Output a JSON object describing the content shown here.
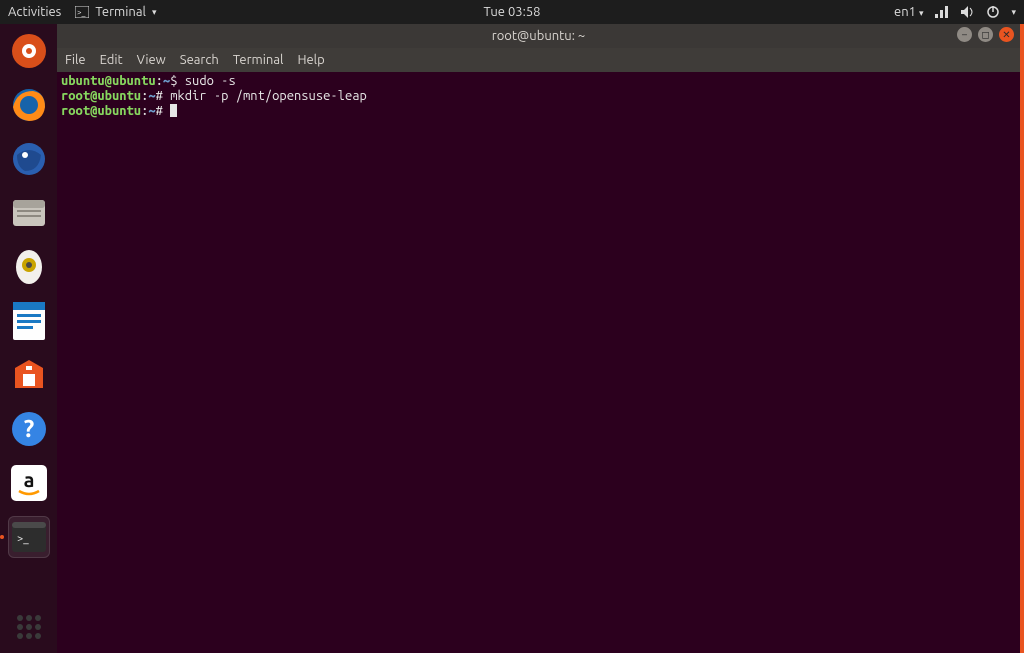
{
  "top": {
    "activities": "Activities",
    "app_label": "Terminal",
    "clock": "Tue 03:58",
    "lang": "en1"
  },
  "window": {
    "title": "root@ubuntu: ~"
  },
  "menu": {
    "file": "File",
    "edit": "Edit",
    "view": "View",
    "search": "Search",
    "terminal": "Terminal",
    "help": "Help"
  },
  "terminal": {
    "lines": [
      {
        "user": "ubuntu@ubuntu",
        "path": "~",
        "sep": "$",
        "cmd": "sudo -s"
      },
      {
        "user": "root@ubuntu",
        "path": "~",
        "sep": "#",
        "cmd": "mkdir -p /mnt/opensuse-leap"
      },
      {
        "user": "root@ubuntu",
        "path": "~",
        "sep": "#",
        "cmd": "",
        "cursor": true
      }
    ]
  },
  "dock": {
    "items": [
      {
        "name": "files-icon"
      },
      {
        "name": "firefox-icon"
      },
      {
        "name": "thunderbird-icon"
      },
      {
        "name": "filemanager-icon"
      },
      {
        "name": "rhythmbox-icon"
      },
      {
        "name": "writer-icon"
      },
      {
        "name": "software-icon"
      },
      {
        "name": "help-icon"
      },
      {
        "name": "amazon-icon"
      },
      {
        "name": "terminal-icon",
        "active": true,
        "running": true
      }
    ]
  }
}
